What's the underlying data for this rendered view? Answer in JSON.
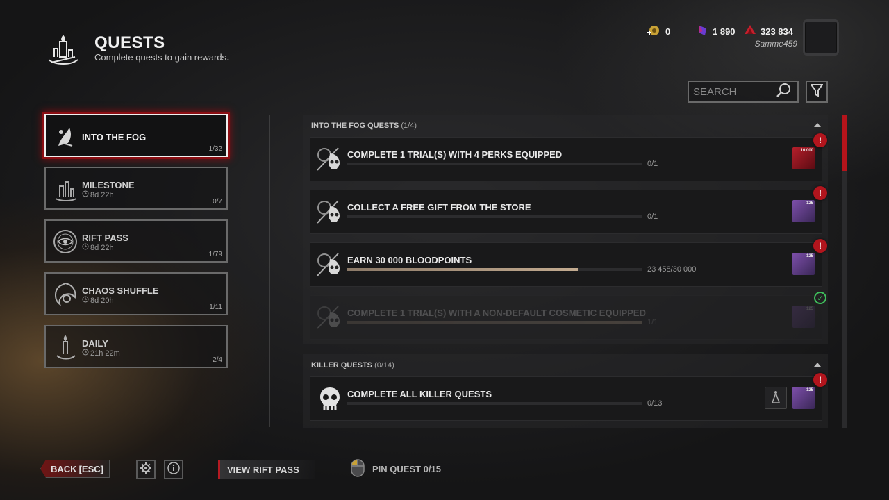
{
  "header": {
    "title": "QUESTS",
    "subtitle": "Complete quests to gain rewards."
  },
  "currencies": {
    "rift_shards": "0",
    "auric_cells": "1 890",
    "bloodpoints": "323 834"
  },
  "player": {
    "username": "Samme459"
  },
  "search": {
    "placeholder": "SEARCH"
  },
  "categories": [
    {
      "label": "INTO THE FOG",
      "time": "",
      "count": "1/32",
      "icon": "fog-icon",
      "active": true
    },
    {
      "label": "MILESTONE",
      "time": "8d 22h",
      "count": "0/7",
      "icon": "candles-icon",
      "active": false
    },
    {
      "label": "RIFT PASS",
      "time": "8d 22h",
      "count": "1/79",
      "icon": "rift-eye-icon",
      "active": false
    },
    {
      "label": "CHAOS SHUFFLE",
      "time": "8d 20h",
      "count": "1/11",
      "icon": "chaos-icon",
      "active": false
    },
    {
      "label": "DAILY",
      "time": "21h 22m",
      "count": "2/4",
      "icon": "candle-icon",
      "active": false
    }
  ],
  "sections": {
    "fog": {
      "title": "INTO THE FOG QUESTS",
      "count": "(1/4)"
    },
    "killer": {
      "title": "KILLER QUESTS",
      "count": "(0/14)"
    }
  },
  "quests": [
    {
      "title": "COMPLETE 1 TRIAL(S) WITH 4 PERKS EQUIPPED",
      "progress": "0/1",
      "fraction": 0,
      "reward": "10 000",
      "reward_type": "auric-cells",
      "alert": "!"
    },
    {
      "title": "COLLECT A FREE GIFT FROM THE STORE",
      "progress": "0/1",
      "fraction": 0,
      "reward": "125",
      "reward_type": "rift-shards",
      "alert": "!"
    },
    {
      "title": "EARN 30 000 BLOODPOINTS",
      "progress": "23 458/30 000",
      "fraction": 0.782,
      "reward": "125",
      "reward_type": "rift-shards",
      "alert": "!"
    },
    {
      "title": "COMPLETE 1 TRIAL(S) WITH A NON-DEFAULT COSMETIC EQUIPPED",
      "progress": "1/1",
      "fraction": 1,
      "reward": "125",
      "reward_type": "rift-shards",
      "completed_mark": "✓"
    },
    {
      "title": "COMPLETE ALL KILLER QUESTS",
      "progress": "0/13",
      "fraction": 0,
      "reward": "125",
      "reward_type": "rift-shards",
      "alert": "!"
    }
  ],
  "footer": {
    "back_label": "BACK",
    "back_key": "[ESC]",
    "view_rift_label": "VIEW RIFT PASS",
    "pin_quest_label": "PIN QUEST 0/15"
  },
  "colors": {
    "accent_red": "#b51a22",
    "alert_red": "#b2151d",
    "complete_green": "#3fbf5c",
    "progress_fill": "#c3ab90"
  }
}
